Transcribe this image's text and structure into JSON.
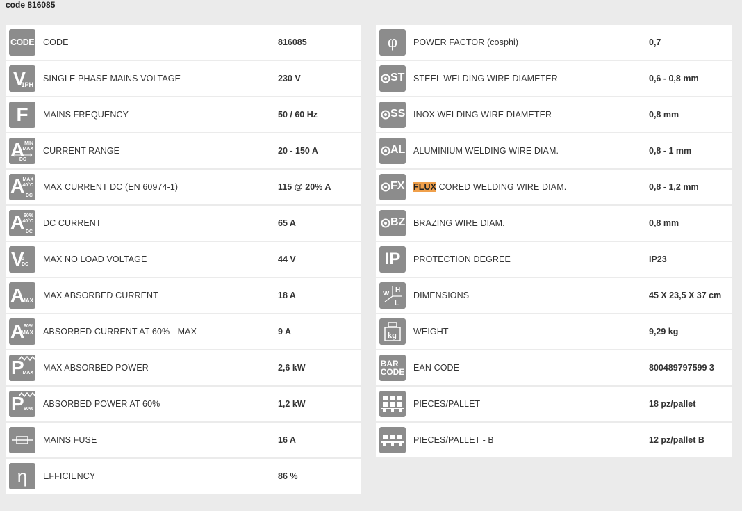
{
  "title": "code 816085",
  "left": [
    {
      "icon": "code-icon",
      "icon_text": "CODE",
      "label": "CODE",
      "value": "816085"
    },
    {
      "icon": "voltage-1ph-icon",
      "icon_text": "V",
      "icon_sub": "1PH",
      "label": "SINGLE PHASE MAINS VOLTAGE",
      "value": "230 V"
    },
    {
      "icon": "frequency-icon",
      "icon_text": "F",
      "label": "MAINS FREQUENCY",
      "value": "50 / 60 Hz"
    },
    {
      "icon": "current-range-icon",
      "icon_text": "A",
      "icon_sub": "MIN MAX",
      "icon_sub2": "DC",
      "label": "CURRENT RANGE",
      "value": "20 - 150 A"
    },
    {
      "icon": "max-current-dc-icon",
      "icon_text": "A",
      "icon_sub": "MAX 40°C",
      "icon_sub2": "DC",
      "label": "MAX CURRENT DC (EN 60974-1)",
      "value": "115 @ 20% A"
    },
    {
      "icon": "dc-current-icon",
      "icon_text": "A",
      "icon_sub": "60% 40°C",
      "icon_sub2": "DC",
      "label": "DC CURRENT",
      "value": "65 A"
    },
    {
      "icon": "no-load-voltage-icon",
      "icon_text": "V",
      "icon_sub": "0 DC",
      "label": "MAX NO LOAD VOLTAGE",
      "value": "44 V"
    },
    {
      "icon": "max-absorbed-current-icon",
      "icon_text": "A",
      "icon_sub": "MAX",
      "label": "MAX ABSORBED CURRENT",
      "value": "18 A"
    },
    {
      "icon": "absorbed-current-60-icon",
      "icon_text": "A",
      "icon_sub": "60% MAX",
      "label": "ABSORBED CURRENT AT 60% - MAX",
      "value": "9 A"
    },
    {
      "icon": "max-absorbed-power-icon",
      "icon_text": "P",
      "icon_sub": "MAX",
      "label": "MAX ABSORBED POWER",
      "value": "2,6 kW"
    },
    {
      "icon": "absorbed-power-60-icon",
      "icon_text": "P",
      "icon_sub": "60%",
      "label": "ABSORBED POWER AT 60%",
      "value": "1,2 kW"
    },
    {
      "icon": "fuse-icon",
      "icon_text": "",
      "label": "MAINS FUSE",
      "value": "16 A"
    },
    {
      "icon": "efficiency-icon",
      "icon_text": "η",
      "label": "EFFICIENCY",
      "value": "86 %"
    }
  ],
  "right": [
    {
      "icon": "power-factor-icon",
      "icon_text": "φ",
      "label": "POWER FACTOR (cosphi)",
      "value": "0,7"
    },
    {
      "icon": "steel-wire-icon",
      "icon_text": "ST",
      "label": "STEEL WELDING WIRE DIAMETER",
      "value": "0,6 - 0,8 mm"
    },
    {
      "icon": "inox-wire-icon",
      "icon_text": "SS",
      "label": "INOX WELDING WIRE DIAMETER",
      "value": "0,8 mm"
    },
    {
      "icon": "aluminium-wire-icon",
      "icon_text": "AL",
      "label": "ALUMINIUM WELDING WIRE DIAM.",
      "value": "0,8 - 1 mm"
    },
    {
      "icon": "flux-wire-icon",
      "icon_text": "FX",
      "label_hl": "FLUX",
      "label": " CORED WELDING WIRE DIAM.",
      "value": "0,8 - 1,2 mm"
    },
    {
      "icon": "brazing-wire-icon",
      "icon_text": "BZ",
      "label": "BRAZING WIRE DIAM.",
      "value": "0,8 mm"
    },
    {
      "icon": "protection-degree-icon",
      "icon_text": "IP",
      "label": "PROTECTION DEGREE",
      "value": "IP23"
    },
    {
      "icon": "dimensions-icon",
      "icon_text": "W H L",
      "label": "DIMENSIONS",
      "value": "45 X 23,5 X 37 cm"
    },
    {
      "icon": "weight-icon",
      "icon_text": "kg",
      "label": "WEIGHT",
      "value": "9,29 kg"
    },
    {
      "icon": "barcode-icon",
      "icon_text": "BAR CODE",
      "label": "EAN CODE",
      "value": "800489797599 3"
    },
    {
      "icon": "pallet-icon",
      "icon_text": "",
      "label": "PIECES/PALLET",
      "value": "18 pz/pallet"
    },
    {
      "icon": "pallet-b-icon",
      "icon_text": "",
      "label": "PIECES/PALLET - B",
      "value": "12 pz/pallet B"
    }
  ]
}
